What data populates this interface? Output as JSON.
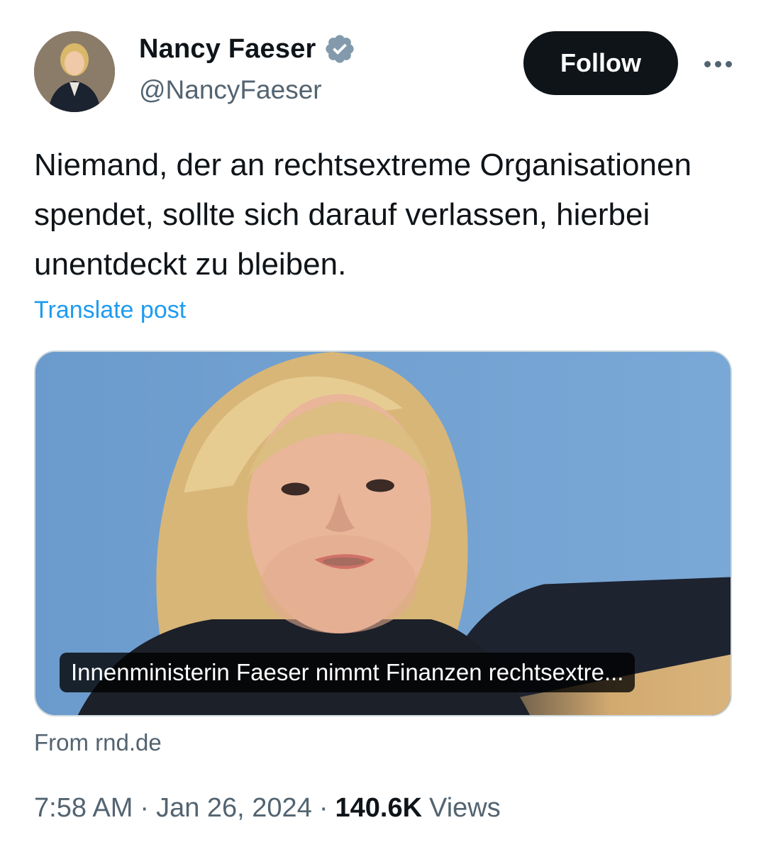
{
  "author": {
    "name": "Nancy Faeser",
    "handle": "@NancyFaeser",
    "verified_icon": "verified-badge-icon",
    "verified_color": "#829aab"
  },
  "actions": {
    "follow_label": "Follow",
    "more_icon": "more-options-icon"
  },
  "post": {
    "text": "Niemand, der an rechtsextreme Organisationen spendet, sollte sich darauf verlassen, hierbei unentdeckt zu bleiben.",
    "translate_label": "Translate post"
  },
  "card": {
    "headline": "Innenministerin Faeser nimmt Finanzen rechtsextre...",
    "source": "From rnd.de"
  },
  "meta": {
    "time": "7:58 AM",
    "separator": "·",
    "date": "Jan 26, 2024",
    "views_count": "140.6K",
    "views_label": "Views"
  },
  "colors": {
    "accent": "#1d9bf0",
    "button_bg": "#0f1419",
    "secondary_text": "#536471"
  }
}
